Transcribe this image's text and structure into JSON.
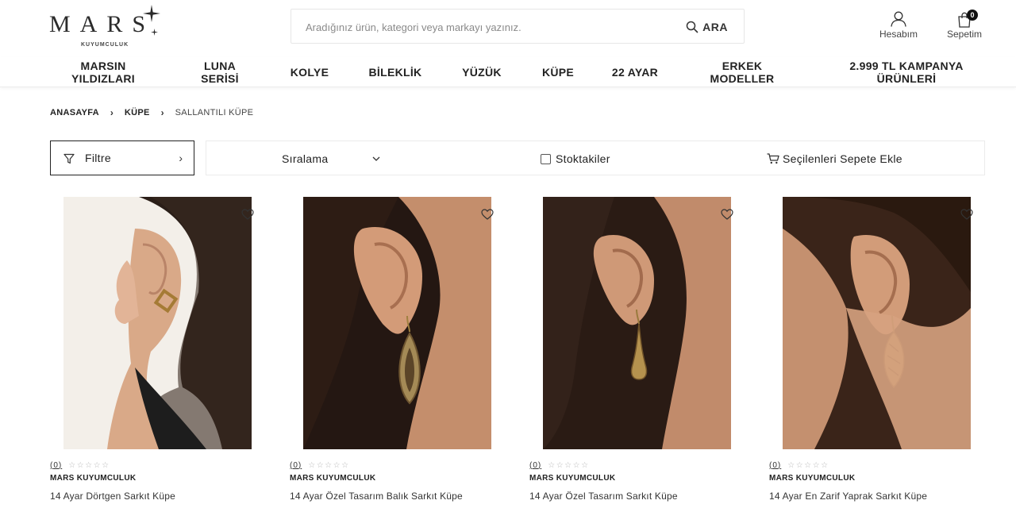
{
  "header": {
    "logo_text": "MARS",
    "logo_subtext": "KUYUMCULUK",
    "search": {
      "placeholder": "Aradığınız ürün, kategori veya markayı yazınız.",
      "value": "",
      "button_label": "ARA"
    },
    "account_label": "Hesabım",
    "cart_label": "Sepetim",
    "cart_count": "0"
  },
  "nav": {
    "items": [
      {
        "label": "MARSIN YILDIZLARI"
      },
      {
        "label": "LUNA SERİSİ"
      },
      {
        "label": "KOLYE"
      },
      {
        "label": "BİLEKLİK"
      },
      {
        "label": "YÜZÜK"
      },
      {
        "label": "KÜPE"
      },
      {
        "label": "22 AYAR"
      },
      {
        "label": "ERKEK MODELLER"
      },
      {
        "label": "2.999 TL KAMPANYA ÜRÜNLERİ"
      }
    ]
  },
  "breadcrumb": {
    "items": [
      {
        "label": "ANASAYFA"
      },
      {
        "label": "KÜPE"
      },
      {
        "label": "SALLANTILI KÜPE"
      }
    ]
  },
  "toolbar": {
    "filter_label": "Filtre",
    "sort_label": "Sıralama",
    "stock_label": "Stoktakiler",
    "stock_checked": false,
    "add_selected_label": "Seçilenleri Sepete Ekle"
  },
  "products": [
    {
      "rating_count": "(0)",
      "brand": "MARS KUYUMCULUK",
      "name": "14 Ayar Dörtgen Sarkıt Küpe",
      "image": "woman-profile-dortgen-earring"
    },
    {
      "rating_count": "(0)",
      "brand": "MARS KUYUMCULUK",
      "name": "14 Ayar Özel Tasarım Balık Sarkıt Küpe",
      "image": "ear-closeup-fish-earring"
    },
    {
      "rating_count": "(0)",
      "brand": "MARS KUYUMCULUK",
      "name": "14 Ayar Özel Tasarım Sarkıt Küpe",
      "image": "ear-closeup-drop-earring"
    },
    {
      "rating_count": "(0)",
      "brand": "MARS KUYUMCULUK",
      "name": "14 Ayar En Zarif Yaprak Sarkıt Küpe",
      "image": "ear-closeup-leaf-earring"
    }
  ],
  "colors": {
    "text": "#222222",
    "border": "#e6e6e6",
    "badge": "#111111",
    "star_empty": "#b9b9b9"
  },
  "icons": {
    "search": "search-icon",
    "account": "user-icon",
    "cart": "shopping-bag-icon",
    "filter": "funnel-icon",
    "sort": "chevron-down-icon",
    "add_cart": "cart-icon",
    "favorite": "heart-icon"
  }
}
